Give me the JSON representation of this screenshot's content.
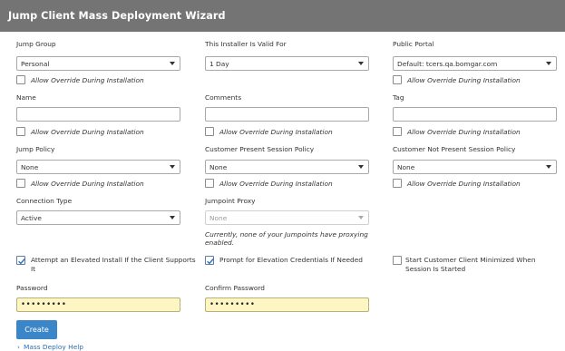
{
  "header": {
    "title": "Jump Client Mass Deployment Wizard"
  },
  "jump_group": {
    "label": "Jump Group",
    "value": "Personal",
    "override": "Allow Override During Installation"
  },
  "valid_for": {
    "label": "This Installer Is Valid For",
    "value": "1 Day"
  },
  "public_portal": {
    "label": "Public Portal",
    "value": "Default: tcers.qa.bomgar.com",
    "override": "Allow Override During Installation"
  },
  "name": {
    "label": "Name",
    "value": "",
    "override": "Allow Override During Installation"
  },
  "comments": {
    "label": "Comments",
    "value": "",
    "override": "Allow Override During Installation"
  },
  "tag": {
    "label": "Tag",
    "value": "",
    "override": "Allow Override During Installation"
  },
  "jump_policy": {
    "label": "Jump Policy",
    "value": "None",
    "override": "Allow Override During Installation"
  },
  "present_policy": {
    "label": "Customer Present Session Policy",
    "value": "None",
    "override": "Allow Override During Installation"
  },
  "not_present_policy": {
    "label": "Customer Not Present Session Policy",
    "value": "None",
    "override": "Allow Override During Installation"
  },
  "connection_type": {
    "label": "Connection Type",
    "value": "Active"
  },
  "jumpoint_proxy": {
    "label": "Jumpoint Proxy",
    "value": "None",
    "note": "Currently, none of your Jumpoints have proxying enabled."
  },
  "options": {
    "elevated_install": {
      "label": "Attempt an Elevated Install If the Client Supports It",
      "checked": true
    },
    "prompt_elevation": {
      "label": "Prompt for Elevation Credentials If Needed",
      "checked": true
    },
    "start_minimized": {
      "label": "Start Customer Client Minimized When Session Is Started",
      "checked": false
    }
  },
  "password": {
    "label": "Password",
    "value": "•••••••••"
  },
  "confirm_password": {
    "label": "Confirm Password",
    "value": "•••••••••"
  },
  "create_button": {
    "label": "Create"
  },
  "help_link": {
    "label": "Mass Deploy Help"
  },
  "colors": {
    "header": "#747474",
    "button": "#3a86c8",
    "password_bg": "#fdf6c4",
    "link": "#2c6fb3"
  },
  "icons": {
    "dropdown": "chevron-down-icon",
    "check": "check-icon",
    "help": "chevron-right-icon"
  }
}
